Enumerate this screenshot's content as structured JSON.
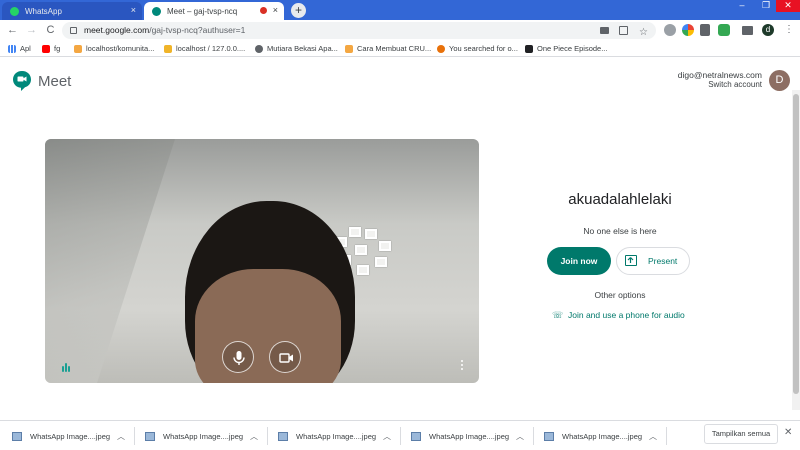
{
  "browser": {
    "tabs": [
      {
        "title": "WhatsApp",
        "active": false,
        "favicon_color": "#25d366"
      },
      {
        "title": "Meet – gaj-tvsp-ncq",
        "active": true,
        "favicon_color": "#00897b"
      }
    ],
    "tab_close_glyph": "×",
    "new_tab_glyph": "+",
    "window_controls": [
      "–",
      "❐",
      "✕"
    ],
    "url_host": "meet.google.com",
    "url_path": "/gaj-tvsp-ncq?authuser=1",
    "profile_initial": "d",
    "nav": {
      "back": "←",
      "forward": "→",
      "reload": "C"
    },
    "bookmarks": [
      {
        "label": "Apl",
        "icon": "apps-grid-icon",
        "color": "#4285f4"
      },
      {
        "label": "fg",
        "icon": "youtube-icon",
        "color": "#ff0000"
      },
      {
        "label": "localhost/komunita...",
        "icon": "bookmark-favicon",
        "color": "#f4a742"
      },
      {
        "label": "localhost / 127.0.0....",
        "icon": "phpmyadmin-icon",
        "color": "#f0b429"
      },
      {
        "label": "Mutiara Bekasi Apa...",
        "icon": "globe-icon",
        "color": "#5f6368"
      },
      {
        "label": "Cara Membuat CRU...",
        "icon": "bookmark-favicon",
        "color": "#f4a742"
      },
      {
        "label": "You searched for o...",
        "icon": "search-favicon",
        "color": "#e8710a"
      },
      {
        "label": "One Piece Episode...",
        "icon": "bookmark-favicon",
        "color": "#202124"
      }
    ]
  },
  "meet": {
    "app_name": "Meet",
    "account_email": "digo@netralnews.com",
    "switch_account": "Switch account",
    "avatar_initial": "D",
    "meeting_name": "akuadalahlelaki",
    "status_text": "No one else is here",
    "join_now": "Join now",
    "present": "Present",
    "other_options": "Other options",
    "join_phone": "Join and use a phone for audio",
    "brand_color": "#00796b"
  },
  "downloads": {
    "items": [
      "WhatsApp Image....jpeg",
      "WhatsApp Image....jpeg",
      "WhatsApp Image....jpeg",
      "WhatsApp Image....jpeg",
      "WhatsApp Image....jpeg"
    ],
    "show_all": "Tampilkan semua",
    "close_glyph": "✕"
  }
}
